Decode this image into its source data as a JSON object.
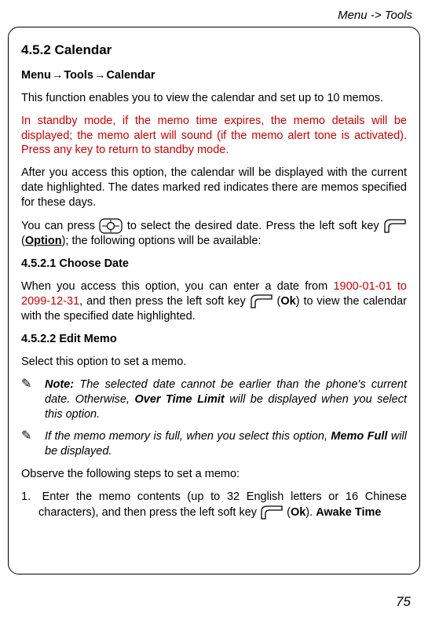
{
  "header": {
    "path": "Menu -> Tools"
  },
  "page_number": "75",
  "section": {
    "number": "4.5.2",
    "title": "Calendar"
  },
  "breadcrumb": {
    "seg1": "Menu",
    "seg2": "Tools",
    "seg3": "Calendar"
  },
  "intro": "This function enables you to view the calendar and set up to 10 memos.",
  "standby_text": "In standby mode, if the memo time expires, the memo details will be displayed; the memo alert will sound (if the memo alert tone is activated). Press any key to return to standby mode.",
  "after_access": "After you access this option, the calendar will be displayed with the current date highlighted. The dates marked red indicates there are memos specified for these days.",
  "press_line": {
    "p1": "You can press ",
    "p2": " to select the desired date. Press the left soft key ",
    "option_label": "Option",
    "p3": "); the following options will be available:"
  },
  "sub1": {
    "heading": "4.5.2.1 Choose Date",
    "line_a": "When you access this option, you can enter a date from ",
    "date_range_a": "1900-01-01 to ",
    "date_range_b": "2099-12-31",
    "line_b1": ", and then press the left soft key ",
    "ok_label": "Ok",
    "line_b2": ") to view the calendar with the specified date highlighted."
  },
  "sub2": {
    "heading": "4.5.2.2 Edit Memo",
    "intro": "Select this option to set a memo.",
    "note1_a": "Note:",
    "note1_b": " The selected date cannot be earlier than the phone's current date. Otherwise, ",
    "note1_bold": "Over Time Limit",
    "note1_c": " will be displayed when you select this option.",
    "note2_a": "If the memo memory is full, when you select this option, ",
    "note2_bold": "Memo Full",
    "note2_b": " will be displayed.",
    "observe": "Observe the following steps to set a memo:",
    "step1_a": "1. Enter the memo contents (up to 32 English letters or 16 Chinese characters), and then press the left soft key ",
    "step1_ok": "Ok",
    "step1_b": "). ",
    "awake": "Awake Time"
  }
}
